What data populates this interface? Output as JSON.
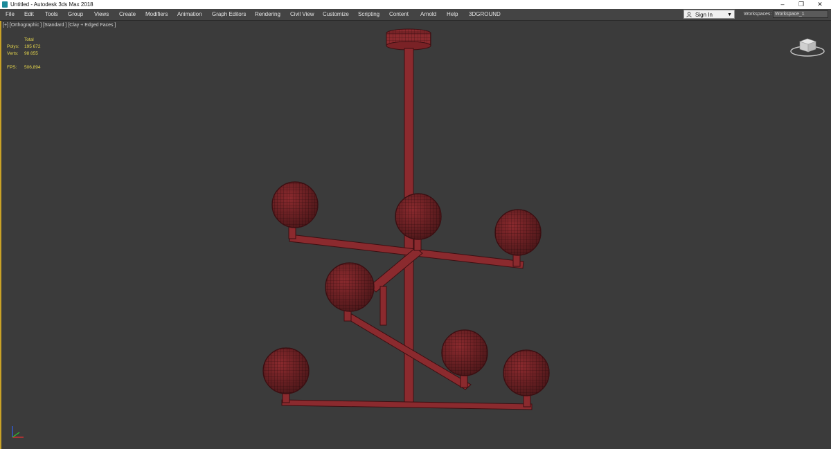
{
  "window": {
    "title": "Untitled - Autodesk 3ds Max 2018",
    "controls": [
      "–",
      "❐",
      "✕"
    ]
  },
  "menu": [
    "File",
    "Edit",
    "Tools",
    "Group",
    "Views",
    "Create",
    "Modifiers",
    "Animation",
    "Graph Editors",
    "Rendering",
    "Civil View",
    "Customize",
    "Scripting",
    "Content",
    "Arnold",
    "Help",
    "3DGROUND"
  ],
  "account": {
    "sign_in": "Sign In"
  },
  "workspaces": {
    "label": "Workspaces:",
    "value": "Workspace_1"
  },
  "viewport": {
    "label": "[+] [Orthographic ] [Standard ] [Clay + Edged Faces ]",
    "stats": {
      "header": "Total",
      "polys_label": "Polys:",
      "polys": "195 672",
      "verts_label": "Verts:",
      "verts": "98 855",
      "fps_label": "FPS:",
      "fps": "506,894"
    }
  },
  "colors": {
    "model": "#8b2a2e",
    "background": "#3b3b3b",
    "active_border": "#c9a227",
    "stats_text": "#e8d84c"
  },
  "icons": {
    "app": "3dsmax-app-icon",
    "user": "user-icon",
    "viewcube": "viewcube-icon",
    "axis": "axis-tripod-icon"
  }
}
